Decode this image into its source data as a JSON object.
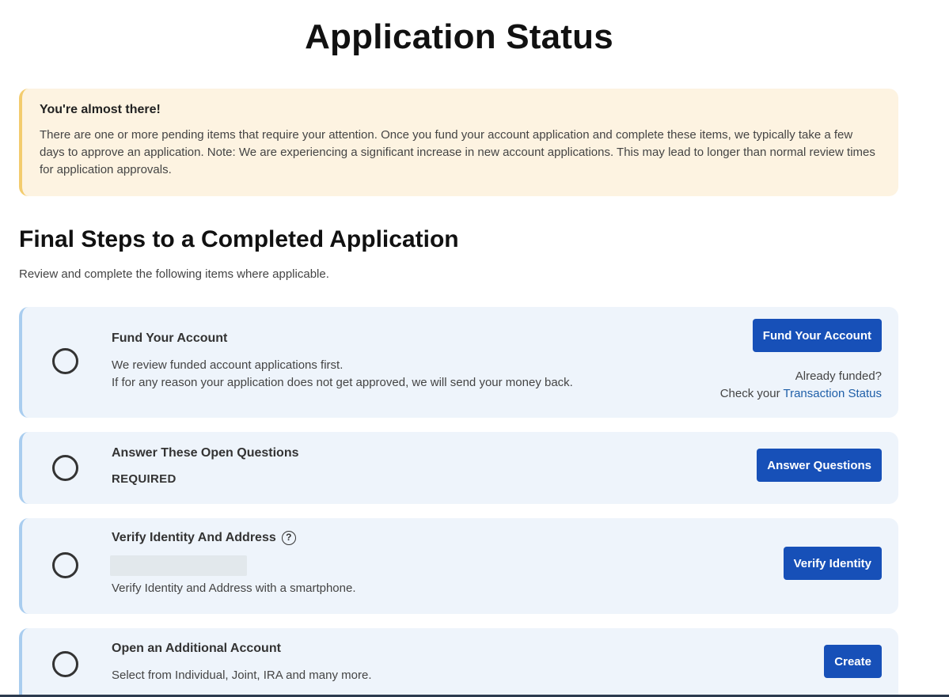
{
  "page": {
    "title": "Application Status"
  },
  "alert": {
    "title": "You're almost there!",
    "body": "There are one or more pending items that require your attention. Once you fund your account application and complete these items, we typically take a few days to approve an application. Note: We are experiencing a significant increase in new account applications. This may lead to longer than normal review times for application approvals."
  },
  "section": {
    "title": "Final Steps to a Completed Application",
    "subtitle": "Review and complete the following items where applicable."
  },
  "steps": [
    {
      "title": "Fund Your Account",
      "line1": "We review funded account applications first.",
      "line2": "If for any reason your application does not get approved, we will send your money back.",
      "button": "Fund Your Account",
      "already_funded": "Already funded?",
      "check_your": "Check your",
      "transaction_link": "Transaction Status"
    },
    {
      "title": "Answer These Open Questions",
      "required": "REQUIRED",
      "button": "Answer Questions"
    },
    {
      "title": "Verify Identity And Address",
      "help_icon": "?",
      "text": "Verify Identity and Address with a smartphone.",
      "button": "Verify Identity"
    },
    {
      "title": "Open an Additional Account",
      "text": "Select from Individual, Joint, IRA and many more.",
      "button": "Create"
    }
  ],
  "colors": {
    "primary_button": "#1750b8",
    "alert_bg": "#fdf3e1",
    "alert_border": "#f3cc6e",
    "step_bg": "#eef4fb",
    "step_border": "#a9cdef",
    "link": "#1f5fa8"
  }
}
